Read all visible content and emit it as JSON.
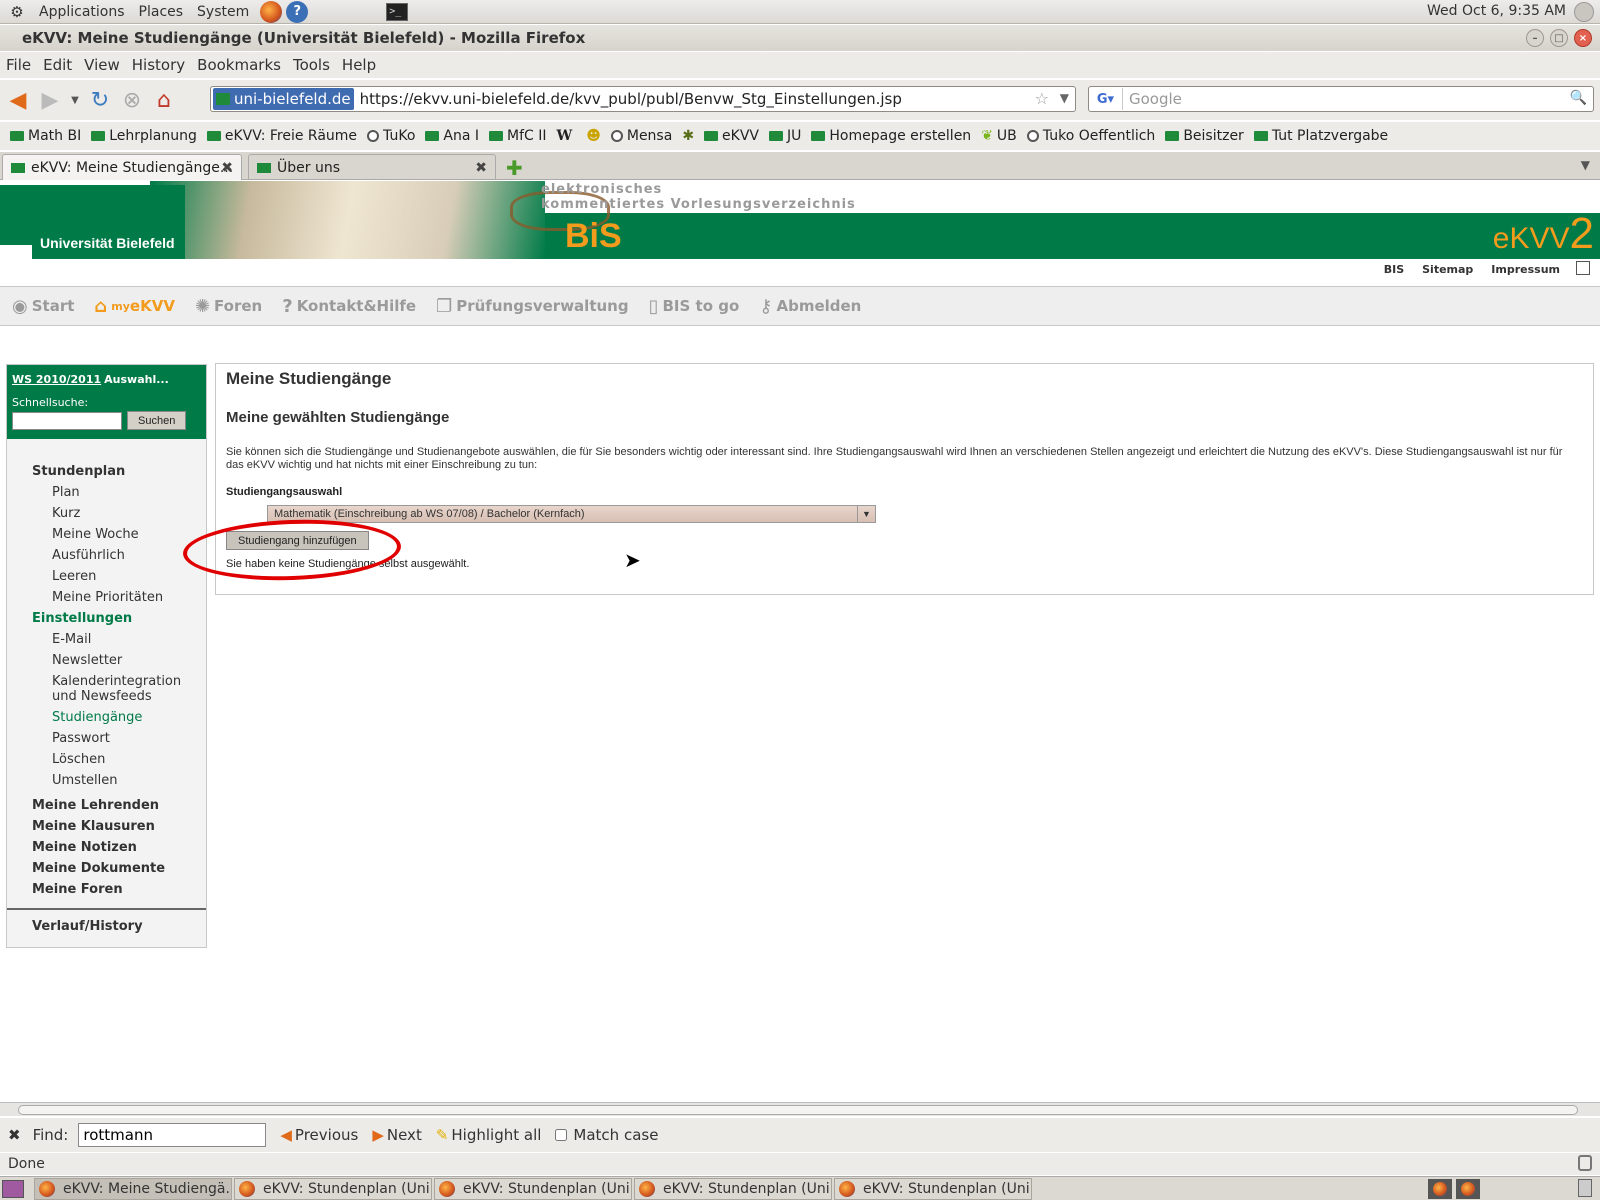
{
  "desktop": {
    "menus": [
      "Applications",
      "Places",
      "System"
    ],
    "clock": "Wed Oct  6,  9:35 AM"
  },
  "window": {
    "title": "eKVV: Meine Studiengänge (Universität Bielefeld) - Mozilla Firefox"
  },
  "menubar": [
    "File",
    "Edit",
    "View",
    "History",
    "Bookmarks",
    "Tools",
    "Help"
  ],
  "navbar": {
    "identity": "uni-bielefeld.de",
    "url": "https://ekvv.uni-bielefeld.de/kvv_publ/publ/Benvw_Stg_Einstellungen.jsp",
    "search_placeholder": "Google"
  },
  "bookmarks": [
    "Math BI",
    "Lehrplanung",
    "eKVV: Freie Räume",
    "TuKo",
    "Ana I",
    "MfC II",
    "W",
    "",
    "Mensa",
    "",
    "eKVV",
    "JU",
    "Homepage erstellen",
    "UB",
    "Tuko Oeffentlich",
    "Beisitzer",
    "Tut Platzvergabe"
  ],
  "tabs": [
    {
      "label": "eKVV: Meine Studiengänge...",
      "active": true
    },
    {
      "label": "Über uns",
      "active": false
    }
  ],
  "site": {
    "university": "Universität Bielefeld",
    "tagline_1": "elektronisches",
    "tagline_2": "kommentiertes Vorlesungsverzeichnis",
    "bis_logo": "BiS",
    "ekvv_logo": "eKVV",
    "ekvv_version": "2",
    "top_links": [
      "BIS",
      "Sitemap",
      "Impressum"
    ],
    "main_nav": [
      {
        "label": "Start",
        "icon": "radio-icon"
      },
      {
        "label": "eKVV",
        "prefix": "my",
        "icon": "home-icon",
        "active": true
      },
      {
        "label": "Foren",
        "icon": "gear-icon"
      },
      {
        "label": "Kontakt&Hilfe",
        "icon": "question-icon"
      },
      {
        "label": "Prüfungsverwaltung",
        "icon": "windows-icon"
      },
      {
        "label": "BIS to go",
        "icon": "phone-icon"
      },
      {
        "label": "Abmelden",
        "icon": "key-icon"
      }
    ]
  },
  "sidebar": {
    "semester": "WS 2010/2011",
    "semester_action": "Auswahl...",
    "quicksearch_label": "Schnellsuche:",
    "search_button": "Suchen",
    "nav": [
      {
        "label": "Stundenplan",
        "type": "h"
      },
      {
        "label": "Plan",
        "type": "s"
      },
      {
        "label": "Kurz",
        "type": "s"
      },
      {
        "label": "Meine Woche",
        "type": "s"
      },
      {
        "label": "Ausführlich",
        "type": "s"
      },
      {
        "label": "Leeren",
        "type": "s"
      },
      {
        "label": "Meine Prioritäten",
        "type": "s"
      },
      {
        "label": "Einstellungen",
        "type": "h",
        "green": true
      },
      {
        "label": "E-Mail",
        "type": "s"
      },
      {
        "label": "Newsletter",
        "type": "s"
      },
      {
        "label": "Kalenderintegration und Newsfeeds",
        "type": "s",
        "multi": true
      },
      {
        "label": "Studiengänge",
        "type": "s",
        "green": true
      },
      {
        "label": "Passwort",
        "type": "s"
      },
      {
        "label": "Löschen",
        "type": "s"
      },
      {
        "label": "Umstellen",
        "type": "s"
      },
      {
        "label": "Meine Lehrenden",
        "type": "h",
        "gap": true
      },
      {
        "label": "Meine Klausuren",
        "type": "h"
      },
      {
        "label": "Meine Notizen",
        "type": "h"
      },
      {
        "label": "Meine Dokumente",
        "type": "h"
      },
      {
        "label": "Meine Foren",
        "type": "h"
      },
      {
        "label": "Verlauf/History",
        "type": "h",
        "sep": true
      }
    ]
  },
  "main": {
    "title": "Meine Studiengänge",
    "subtitle": "Meine gewählten Studiengänge",
    "description": "Sie können sich die Studiengänge und Studienangebote auswählen, die für Sie besonders wichtig oder interessant sind. Ihre Studiengangsauswahl wird Ihnen an verschiedenen Stellen angezeigt und erleichtert die Nutzung des eKVV's. Diese Studiengangsauswahl ist nur für das eKVV wichtig und hat nichts mit einer Einschreibung zu tun:",
    "select_label": "Studiengangsauswahl",
    "select_value": "Mathematik (Einschreibung ab WS 07/08) / Bachelor (Kernfach)",
    "add_button": "Studiengang hinzufügen",
    "empty_message": "Sie haben keine Studiengänge selbst ausgewählt."
  },
  "findbar": {
    "label": "Find:",
    "value": "rottmann",
    "previous": "Previous",
    "next": "Next",
    "highlight": "Highlight all",
    "match_case": "Match case"
  },
  "status": "Done",
  "taskbar": [
    {
      "label": "eKVV: Meine Studiengä...",
      "active": true
    },
    {
      "label": "eKVV: Stundenplan (Uni...",
      "active": false
    },
    {
      "label": "eKVV: Stundenplan (Uni...",
      "active": false
    },
    {
      "label": "eKVV: Stundenplan (Uni...",
      "active": false
    },
    {
      "label": "eKVV: Stundenplan (Uni...",
      "active": false
    }
  ],
  "colors": {
    "brand_green": "#007b48",
    "accent_orange": "#f39b1c",
    "annotation_red": "#e00000"
  }
}
